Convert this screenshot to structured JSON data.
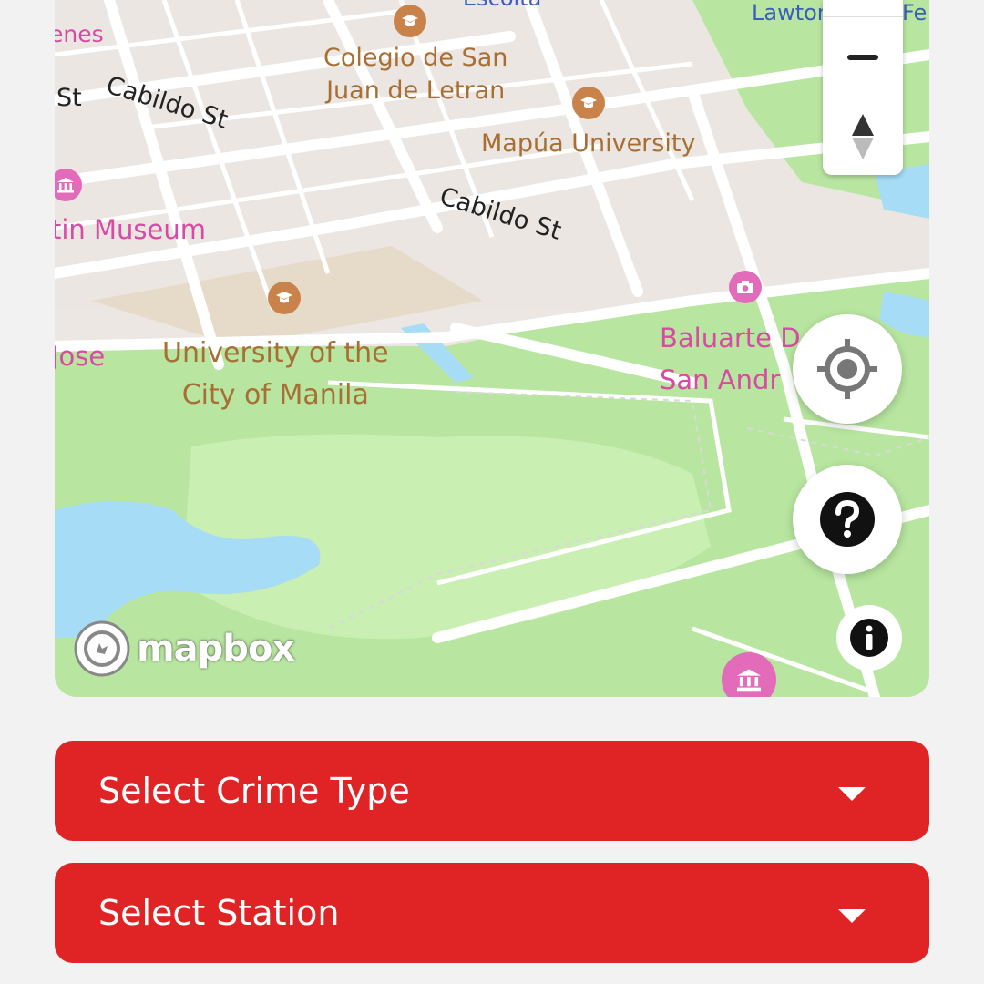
{
  "map": {
    "labels": {
      "escolta": "Escolta",
      "lawton": "Lawton",
      "fe": "Fe",
      "enes": "enes",
      "cabildo_top": "Cabildo St",
      "st_left": "St",
      "colegio": "Colegio de San\nJuan de Letran",
      "mapua": "Mapúa University",
      "museum": "tin Museum",
      "cabildo_mid": "Cabildo St",
      "jose": "Jose",
      "plm": "University of the\nCity of Manila",
      "baluarte": "Baluarte D\nSan Andr"
    },
    "attribution": "mapbox",
    "icons": {
      "zoom_out": "minus-icon",
      "compass": "compass-icon",
      "locate": "crosshair-icon",
      "help": "question-icon",
      "info": "info-icon"
    }
  },
  "form": {
    "crime_type": {
      "label": "Select Crime Type"
    },
    "station": {
      "label": "Select Station"
    }
  },
  "colors": {
    "accent": "#e02324"
  }
}
